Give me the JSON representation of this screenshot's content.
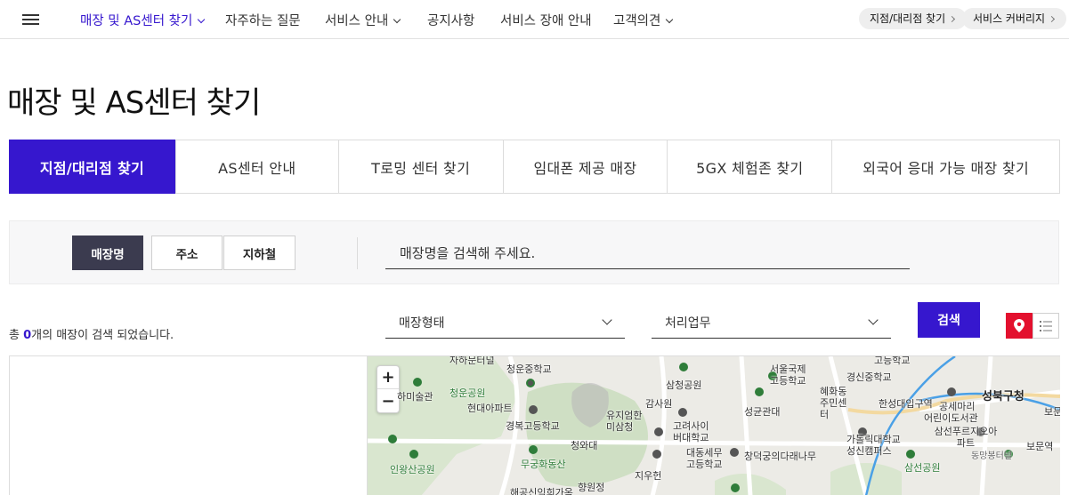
{
  "nav": {
    "items": [
      {
        "label": "매장 및 AS센터 찾기",
        "active": true,
        "has_dropdown": true
      },
      {
        "label": "자주하는 질문",
        "active": false,
        "has_dropdown": false
      },
      {
        "label": "서비스 안내",
        "active": false,
        "has_dropdown": true
      },
      {
        "label": "공지사항",
        "active": false,
        "has_dropdown": false
      },
      {
        "label": "서비스 장애 안내",
        "active": false,
        "has_dropdown": false
      },
      {
        "label": "고객의견",
        "active": false,
        "has_dropdown": true
      }
    ],
    "quick_links": [
      "지점/대리점 찾기",
      "서비스 커버리지"
    ]
  },
  "page_title": "매장 및 AS센터 찾기",
  "tabs": [
    {
      "label": "지점/대리점 찾기",
      "active": true
    },
    {
      "label": "AS센터 안내",
      "active": false
    },
    {
      "label": "T로밍 센터 찾기",
      "active": false
    },
    {
      "label": "임대폰 제공 매장",
      "active": false
    },
    {
      "label": "5GX 체험존 찾기",
      "active": false
    },
    {
      "label": "외국어 응대 가능 매장 찾기",
      "active": false
    }
  ],
  "search": {
    "modes": [
      {
        "label": "매장명",
        "active": true
      },
      {
        "label": "주소",
        "active": false
      },
      {
        "label": "지하철",
        "active": false
      }
    ],
    "placeholder": "매장명을 검색해 주세요."
  },
  "result": {
    "prefix": "총 ",
    "count": "0",
    "suffix": "개의 매장이 검색 되었습니다."
  },
  "filters": {
    "store_type": "매장형태",
    "business": "처리업무",
    "search_button": "검색"
  },
  "map": {
    "zoom_in": "+",
    "zoom_out": "−",
    "labels": {
      "l1": "자하문터널",
      "l2": "청운중학교",
      "l3": "서울국제고등학교",
      "l4": "경신중학교",
      "l5": "삼청공원",
      "l6": "하미술관",
      "l7": "청운공원",
      "l8": "혜화동주민센터",
      "l9": "한성대입구역",
      "l10": "성북구청",
      "l11": "감사원",
      "l12": "현대아파트",
      "l13": "성균관대",
      "l14": "어린이도서관",
      "l15": "공세마리",
      "l16": "보문",
      "l17": "유지엄한미삼청",
      "l18": "경복고등학교",
      "l19": "고려사이버대학교",
      "l20": "청와대",
      "l21": "가톨릭대학교성신캠퍼스",
      "l22": "삼선푸르지오아파트",
      "l23": "보문역",
      "l24": "대동세무고등학교",
      "l25": "창덕궁의다래나무",
      "l26": "무궁화동산",
      "l27": "인왕산공원",
      "l28": "지우헌",
      "l29": "삼선공원",
      "l30": "향원정",
      "l31": "해공신익희가옥",
      "l32": "동망봉터널",
      "l33": "고등학교"
    }
  },
  "colors": {
    "accent": "#3617ce",
    "dark_button": "#3b3b4f",
    "map_marker": "#e3102e"
  }
}
